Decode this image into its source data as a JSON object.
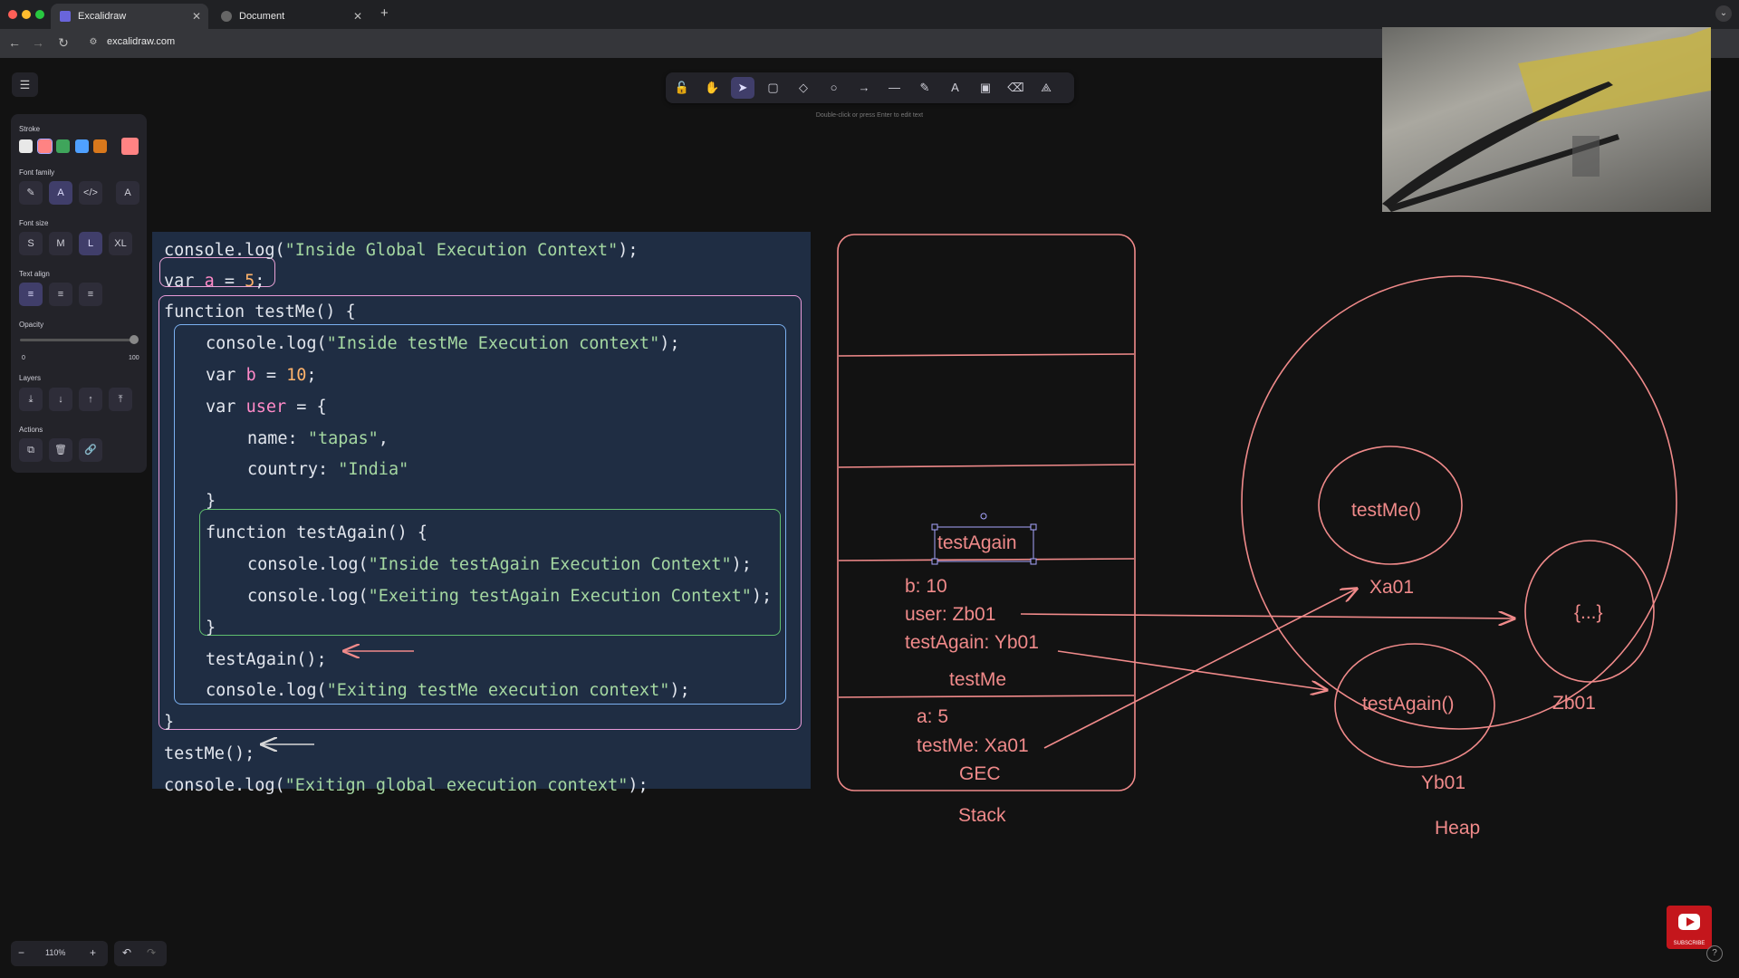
{
  "browser": {
    "tabs": [
      {
        "title": "Excalidraw"
      },
      {
        "title": "Document"
      }
    ],
    "new_tab": "+",
    "url": "excalidraw.com"
  },
  "toolbar": {
    "hint": "Double-click or press Enter to edit text",
    "tools": [
      {
        "name": "lock-tool",
        "icon": "lock-icon",
        "glyph": "🔓"
      },
      {
        "name": "hand-tool",
        "icon": "hand-icon",
        "glyph": "✋"
      },
      {
        "name": "selection-tool",
        "icon": "cursor-icon",
        "glyph": "➤",
        "active": true
      },
      {
        "name": "rectangle-tool",
        "icon": "square-icon",
        "glyph": "▢"
      },
      {
        "name": "diamond-tool",
        "icon": "diamond-icon",
        "glyph": "◇"
      },
      {
        "name": "ellipse-tool",
        "icon": "circle-icon",
        "glyph": "○"
      },
      {
        "name": "arrow-tool",
        "icon": "arrow-icon",
        "glyph": "→"
      },
      {
        "name": "line-tool",
        "icon": "line-icon",
        "glyph": "—"
      },
      {
        "name": "draw-tool",
        "icon": "pencil-icon",
        "glyph": "✎"
      },
      {
        "name": "text-tool",
        "icon": "text-icon",
        "glyph": "A"
      },
      {
        "name": "image-tool",
        "icon": "image-icon",
        "glyph": "▣"
      },
      {
        "name": "eraser-tool",
        "icon": "eraser-icon",
        "glyph": "⌫"
      },
      {
        "name": "library-tool",
        "icon": "shapes-icon",
        "glyph": "⟁"
      }
    ]
  },
  "properties": {
    "stroke_label": "Stroke",
    "stroke_colors": [
      "#e8e8e8",
      "#ff8383",
      "#3fa55b",
      "#4fa0ff",
      "#d9781c"
    ],
    "current_color": "#ff8383",
    "font_family_label": "Font family",
    "font_family_icons": [
      "pencil-icon",
      "font-normal-icon",
      "code-icon",
      "font-text-icon"
    ],
    "font_size_label": "Font size",
    "font_sizes": [
      "S",
      "M",
      "L",
      "XL"
    ],
    "selected_font_size": "L",
    "text_align_label": "Text align",
    "opacity_label": "Opacity",
    "opacity_min": "0",
    "opacity_max": "100",
    "opacity_value": 100,
    "layers_label": "Layers",
    "actions_label": "Actions"
  },
  "code": {
    "lines": [
      {
        "t": "console.log(\"Inside Global Execution Context\");"
      },
      {
        "t": "var a = 5;"
      },
      {
        "t": "function testMe() {"
      },
      {
        "t": "console.log(\"Inside testMe Execution context\");"
      },
      {
        "t": "var b = 10;"
      },
      {
        "t": "var user = {"
      },
      {
        "t": "name: \"tapas\","
      },
      {
        "t": "country: \"India\""
      },
      {
        "t": "}"
      },
      {
        "t": "function testAgain() {"
      },
      {
        "t": "console.log(\"Inside testAgain Execution Context\");"
      },
      {
        "t": "console.log(\"Exeiting testAgain Execution Context\");"
      },
      {
        "t": "}"
      },
      {
        "t": "testAgain();"
      },
      {
        "t": "console.log(\"Exiting testMe execution context\");"
      },
      {
        "t": "}"
      },
      {
        "t": "testMe();"
      },
      {
        "t": "console.log(\"Exitign global execution context\");"
      }
    ]
  },
  "diagram": {
    "stack_label": "Stack",
    "heap_label": "Heap",
    "selected_text": "testAgain",
    "testme_frame": {
      "b": "b: 10",
      "user": "user: Zb01",
      "testAgain": "testAgain: Yb01",
      "name": "testMe"
    },
    "gec_frame": {
      "a": "a: 5",
      "testMe": "testMe: Xa01",
      "name": "GEC"
    },
    "heap_items": [
      {
        "label": "testMe()",
        "address": "Xa01"
      },
      {
        "label": "{...}",
        "address": "Zb01"
      },
      {
        "label": "testAgain()",
        "address": "Yb01"
      }
    ],
    "stroke_color": "#f08a8a"
  },
  "footer": {
    "zoom": "110%",
    "zoom_out": "−",
    "zoom_in": "+",
    "undo": "↶",
    "redo": "↷",
    "subscribe": "SUBSCRIBE"
  }
}
